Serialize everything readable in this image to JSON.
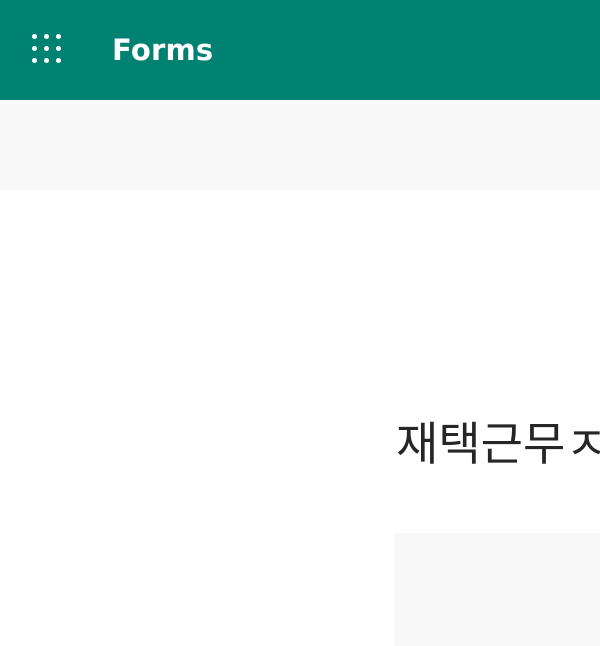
{
  "header": {
    "app_name": "Forms",
    "launcher_icon": "app-launcher-waffle-icon",
    "background_color": "#008272"
  },
  "form": {
    "title": "재택근무ㅈ"
  }
}
